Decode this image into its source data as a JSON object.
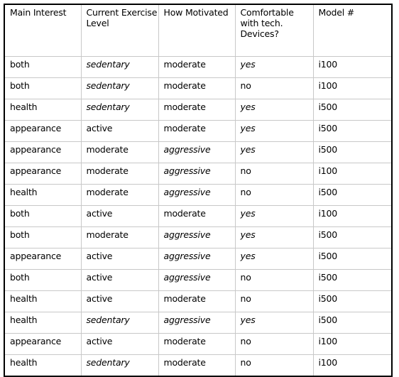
{
  "table": {
    "name": "customer-fitness-survey-table",
    "columns": [
      {
        "id": "main_interest",
        "label": "Main Interest"
      },
      {
        "id": "current_exercise_level",
        "label": "Current Exercise Level"
      },
      {
        "id": "how_motivated",
        "label": "How Motivated"
      },
      {
        "id": "comfortable_with_tech_devices",
        "label": "Comfortable with tech. Devices?"
      },
      {
        "id": "model_number",
        "label": "Model #"
      }
    ],
    "rows": [
      {
        "main_interest": "both",
        "current_exercise_level": "sedentary",
        "how_motivated": "moderate",
        "comfortable_with_tech_devices": "yes",
        "model_number": "i100"
      },
      {
        "main_interest": "both",
        "current_exercise_level": "sedentary",
        "how_motivated": "moderate",
        "comfortable_with_tech_devices": "no",
        "model_number": "i100"
      },
      {
        "main_interest": "health",
        "current_exercise_level": "sedentary",
        "how_motivated": "moderate",
        "comfortable_with_tech_devices": "yes",
        "model_number": "i500"
      },
      {
        "main_interest": "appearance",
        "current_exercise_level": "active",
        "how_motivated": "moderate",
        "comfortable_with_tech_devices": "yes",
        "model_number": "i500"
      },
      {
        "main_interest": "appearance",
        "current_exercise_level": "moderate",
        "how_motivated": "aggressive",
        "comfortable_with_tech_devices": "yes",
        "model_number": "i500"
      },
      {
        "main_interest": "appearance",
        "current_exercise_level": "moderate",
        "how_motivated": "aggressive",
        "comfortable_with_tech_devices": "no",
        "model_number": "i100"
      },
      {
        "main_interest": "health",
        "current_exercise_level": "moderate",
        "how_motivated": "aggressive",
        "comfortable_with_tech_devices": "no",
        "model_number": "i500"
      },
      {
        "main_interest": "both",
        "current_exercise_level": "active",
        "how_motivated": "moderate",
        "comfortable_with_tech_devices": "yes",
        "model_number": "i100"
      },
      {
        "main_interest": "both",
        "current_exercise_level": "moderate",
        "how_motivated": "aggressive",
        "comfortable_with_tech_devices": "yes",
        "model_number": "i500"
      },
      {
        "main_interest": "appearance",
        "current_exercise_level": "active",
        "how_motivated": "aggressive",
        "comfortable_with_tech_devices": "yes",
        "model_number": "i500"
      },
      {
        "main_interest": "both",
        "current_exercise_level": "active",
        "how_motivated": "aggressive",
        "comfortable_with_tech_devices": "no",
        "model_number": "i500"
      },
      {
        "main_interest": "health",
        "current_exercise_level": "active",
        "how_motivated": "moderate",
        "comfortable_with_tech_devices": "no",
        "model_number": "i500"
      },
      {
        "main_interest": "health",
        "current_exercise_level": "sedentary",
        "how_motivated": "aggressive",
        "comfortable_with_tech_devices": "yes",
        "model_number": "i500"
      },
      {
        "main_interest": "appearance",
        "current_exercise_level": "active",
        "how_motivated": "moderate",
        "comfortable_with_tech_devices": "no",
        "model_number": "i100"
      },
      {
        "main_interest": "health",
        "current_exercise_level": "sedentary",
        "how_motivated": "moderate",
        "comfortable_with_tech_devices": "no",
        "model_number": "i100"
      }
    ],
    "style": {
      "outer_border_color": "#000000",
      "inner_border_color": "#c8c8c8",
      "text_color": "#000000",
      "background_color": "#ffffff",
      "slanted_values": [
        "sedentary",
        "yes",
        "aggressive"
      ]
    }
  }
}
